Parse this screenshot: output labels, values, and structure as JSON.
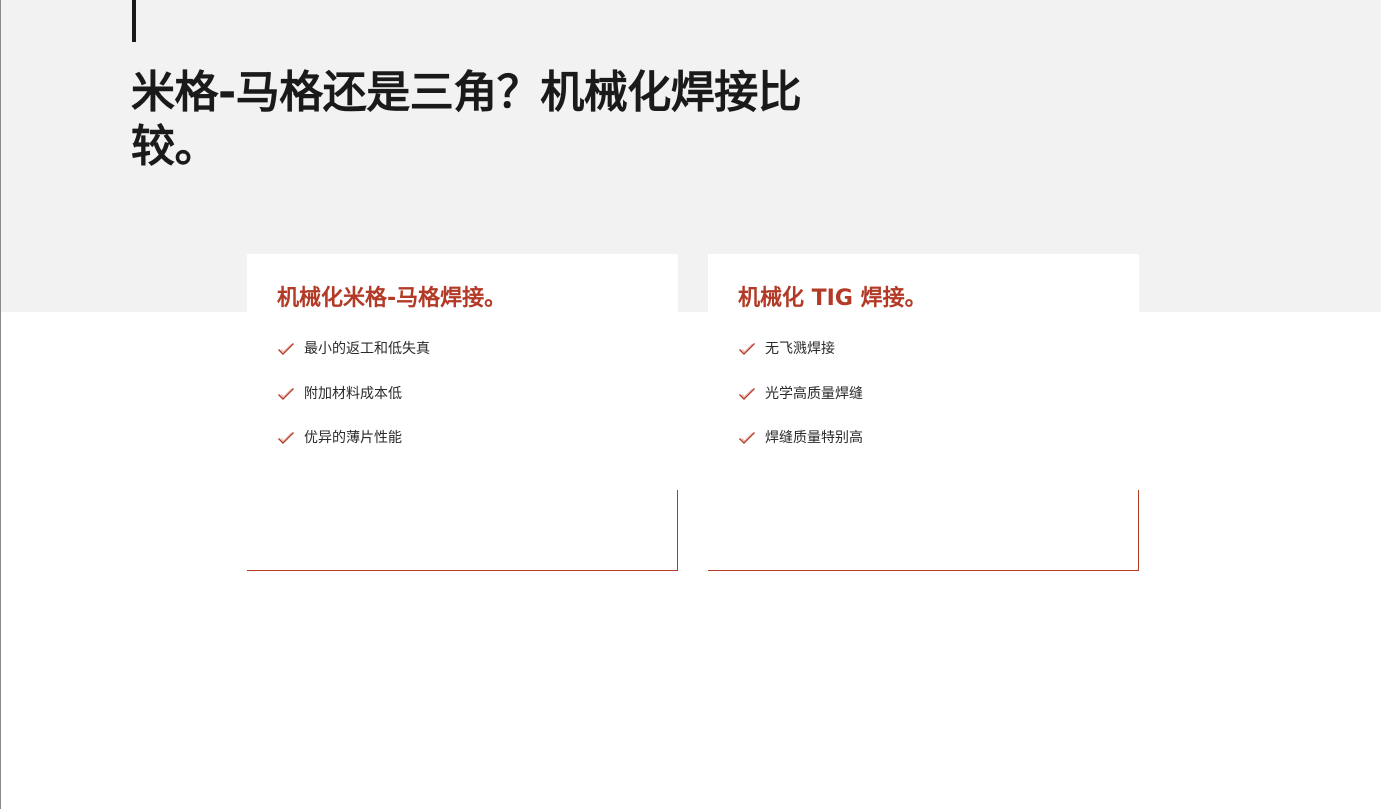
{
  "header": {
    "title": "米格-马格还是三角？机械化焊接比较。"
  },
  "cards": [
    {
      "title": "机械化米格-马格焊接。",
      "features": [
        "最小的返工和低失真",
        "附加材料成本低",
        "优异的薄片性能"
      ]
    },
    {
      "title": "机械化 TIG 焊接。",
      "features": [
        "无飞溅焊接",
        "光学高质量焊缝",
        "焊缝质量特别高"
      ]
    }
  ],
  "icons": {
    "feature": "check-icon"
  },
  "colors": {
    "accent": "#b23a26",
    "band": "#f2f2f2",
    "text": "#1a1a1a"
  }
}
